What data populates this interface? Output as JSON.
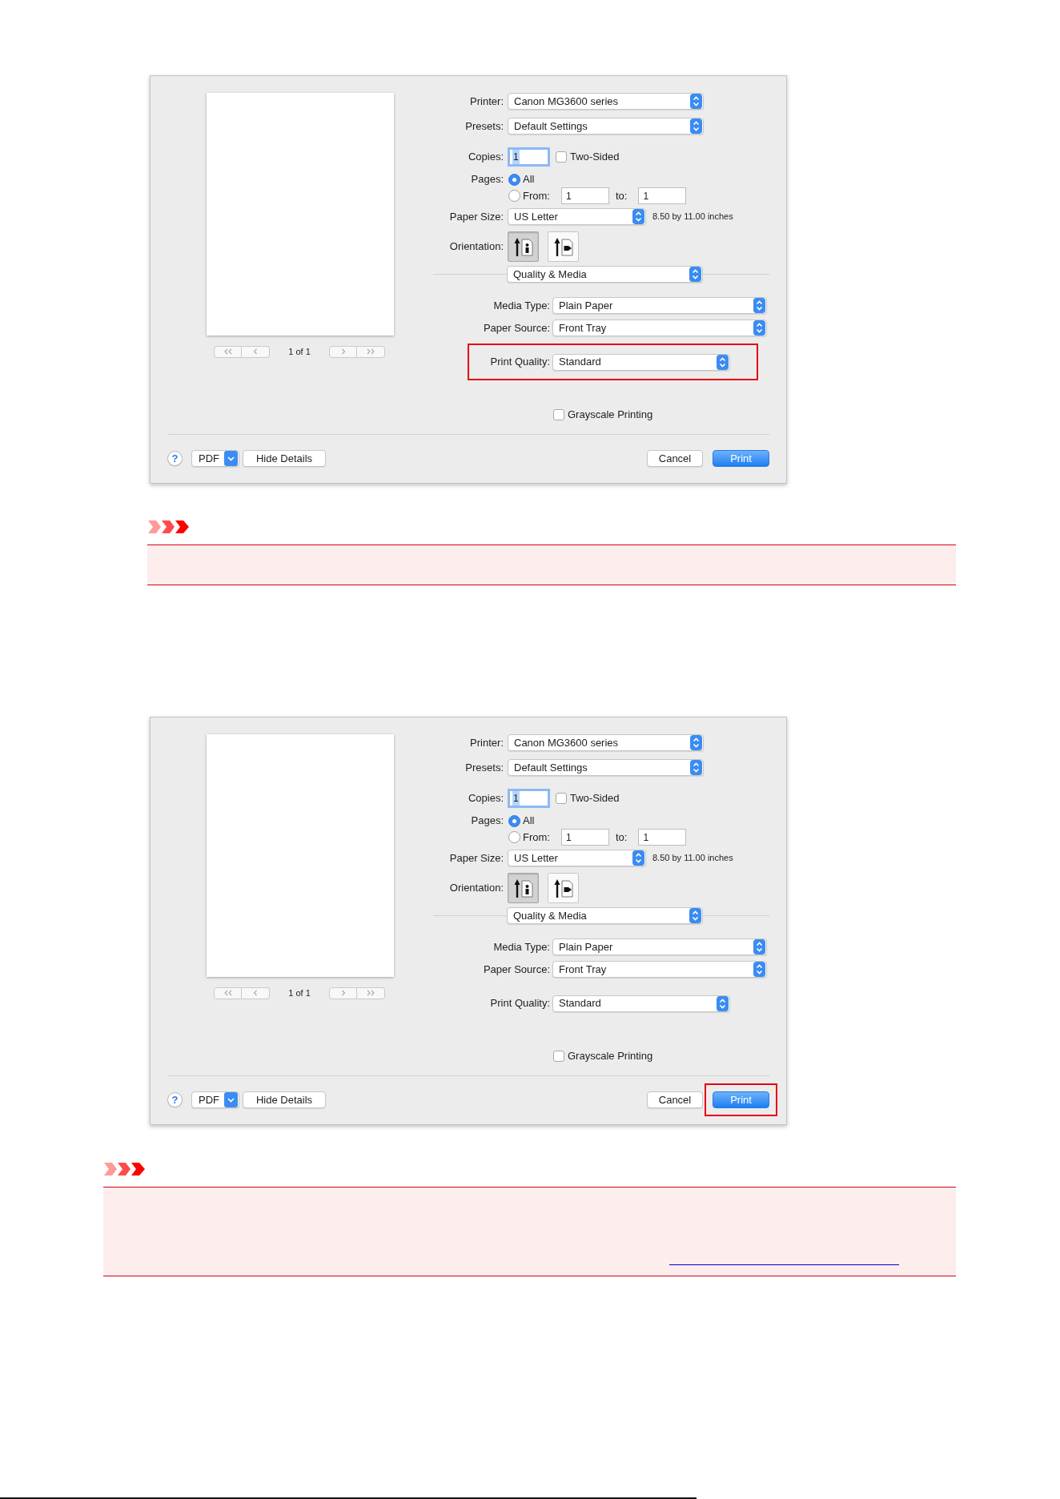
{
  "steps": [
    {
      "dialog": {
        "page_indicator": "1 of 1",
        "printer": {
          "label": "Printer:",
          "value": "Canon MG3600 series"
        },
        "presets": {
          "label": "Presets:",
          "value": "Default Settings"
        },
        "copies": {
          "label": "Copies:",
          "value": "1",
          "two_sided": {
            "label": "Two-Sided",
            "checked": false
          }
        },
        "pages": {
          "label": "Pages:",
          "options": [
            {
              "label": "All",
              "selected": true
            },
            {
              "label": "From:",
              "selected": false
            }
          ],
          "from": "1",
          "to_label": "to:",
          "to": "1"
        },
        "paper_size": {
          "label": "Paper Size:",
          "value": "US Letter",
          "note": "8.50 by 11.00 inches"
        },
        "orientation": {
          "label": "Orientation:",
          "options": [
            {
              "kind": "portrait",
              "selected": true
            },
            {
              "kind": "landscape",
              "selected": false
            }
          ]
        },
        "panel": {
          "value": "Quality & Media"
        },
        "media_type": {
          "label": "Media Type:",
          "value": "Plain Paper"
        },
        "paper_source": {
          "label": "Paper Source:",
          "value": "Front Tray"
        },
        "print_quality": {
          "label": "Print Quality:",
          "value": "Standard",
          "highlighted": true
        },
        "grayscale": {
          "label": "Grayscale Printing",
          "checked": false
        },
        "help": {
          "label": "?"
        },
        "pdf": {
          "label": "PDF"
        },
        "hide_details": {
          "label": "Hide Details"
        },
        "cancel": {
          "label": "Cancel"
        },
        "print": {
          "label": "Print",
          "highlighted": false
        }
      },
      "notice": {
        "link": false
      }
    },
    {
      "dialog": {
        "page_indicator": "1 of 1",
        "printer": {
          "label": "Printer:",
          "value": "Canon MG3600 series"
        },
        "presets": {
          "label": "Presets:",
          "value": "Default Settings"
        },
        "copies": {
          "label": "Copies:",
          "value": "1",
          "two_sided": {
            "label": "Two-Sided",
            "checked": false
          }
        },
        "pages": {
          "label": "Pages:",
          "options": [
            {
              "label": "All",
              "selected": true
            },
            {
              "label": "From:",
              "selected": false
            }
          ],
          "from": "1",
          "to_label": "to:",
          "to": "1"
        },
        "paper_size": {
          "label": "Paper Size:",
          "value": "US Letter",
          "note": "8.50 by 11.00 inches"
        },
        "orientation": {
          "label": "Orientation:",
          "options": [
            {
              "kind": "portrait",
              "selected": true
            },
            {
              "kind": "landscape",
              "selected": false
            }
          ]
        },
        "panel": {
          "value": "Quality & Media"
        },
        "media_type": {
          "label": "Media Type:",
          "value": "Plain Paper"
        },
        "paper_source": {
          "label": "Paper Source:",
          "value": "Front Tray"
        },
        "print_quality": {
          "label": "Print Quality:",
          "value": "Standard",
          "highlighted": false
        },
        "grayscale": {
          "label": "Grayscale Printing",
          "checked": false
        },
        "help": {
          "label": "?"
        },
        "pdf": {
          "label": "PDF"
        },
        "hide_details": {
          "label": "Hide Details"
        },
        "cancel": {
          "label": "Cancel"
        },
        "print": {
          "label": "Print",
          "highlighted": true
        }
      }
    }
  ],
  "notice": {
    "link": true
  }
}
